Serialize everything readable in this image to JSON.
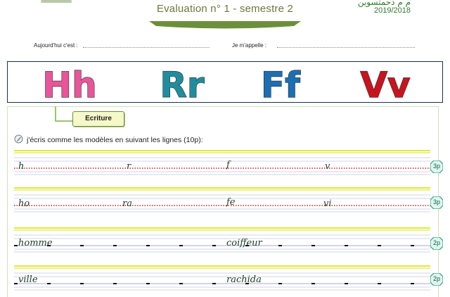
{
  "header": {
    "title": "Evaluation n° 1 - semestre 2",
    "arabic_title": "م م دحمتسوين",
    "school_year": "2019/2018"
  },
  "info": {
    "date_label": "Aujourd'hui c'est :",
    "name_label": "Je m'appelle :"
  },
  "letters_banner": [
    {
      "text": "Hh",
      "color": "#e8559a"
    },
    {
      "text": "Rr",
      "color": "#1f8d9e"
    },
    {
      "text": "Ff",
      "color": "#1c6fb3"
    },
    {
      "text": "Vv",
      "color": "#c8141e"
    }
  ],
  "section": {
    "label": "Ecriture"
  },
  "instruction": {
    "text": "j'écris comme les modèles en suivant les lignes (10p):"
  },
  "rows": [
    {
      "left_model": "h",
      "left_mid": "r",
      "right_model": "f",
      "right_mid": "v",
      "points": "3p",
      "line_style": "red-dots"
    },
    {
      "left_model": "ho",
      "left_mid": "ra",
      "right_model": "fe",
      "right_mid": "vi",
      "points": "3p",
      "line_style": "red-dots"
    },
    {
      "left_model": "homme",
      "left_mid": "",
      "right_model": "coiffeur",
      "right_mid": "",
      "points": "2p",
      "line_style": "black-dashes"
    },
    {
      "left_model": "ville",
      "left_mid": "",
      "right_model": "rachida",
      "right_mid": "",
      "points": "2p",
      "line_style": "black-dashes"
    }
  ],
  "colors": {
    "accent_green": "#6b7a3a",
    "guide_yellow": "#dfe93a",
    "guide_lavender": "#c5c4e2",
    "badge_fill": "#dff6ee",
    "badge_stroke": "#29a37f"
  }
}
